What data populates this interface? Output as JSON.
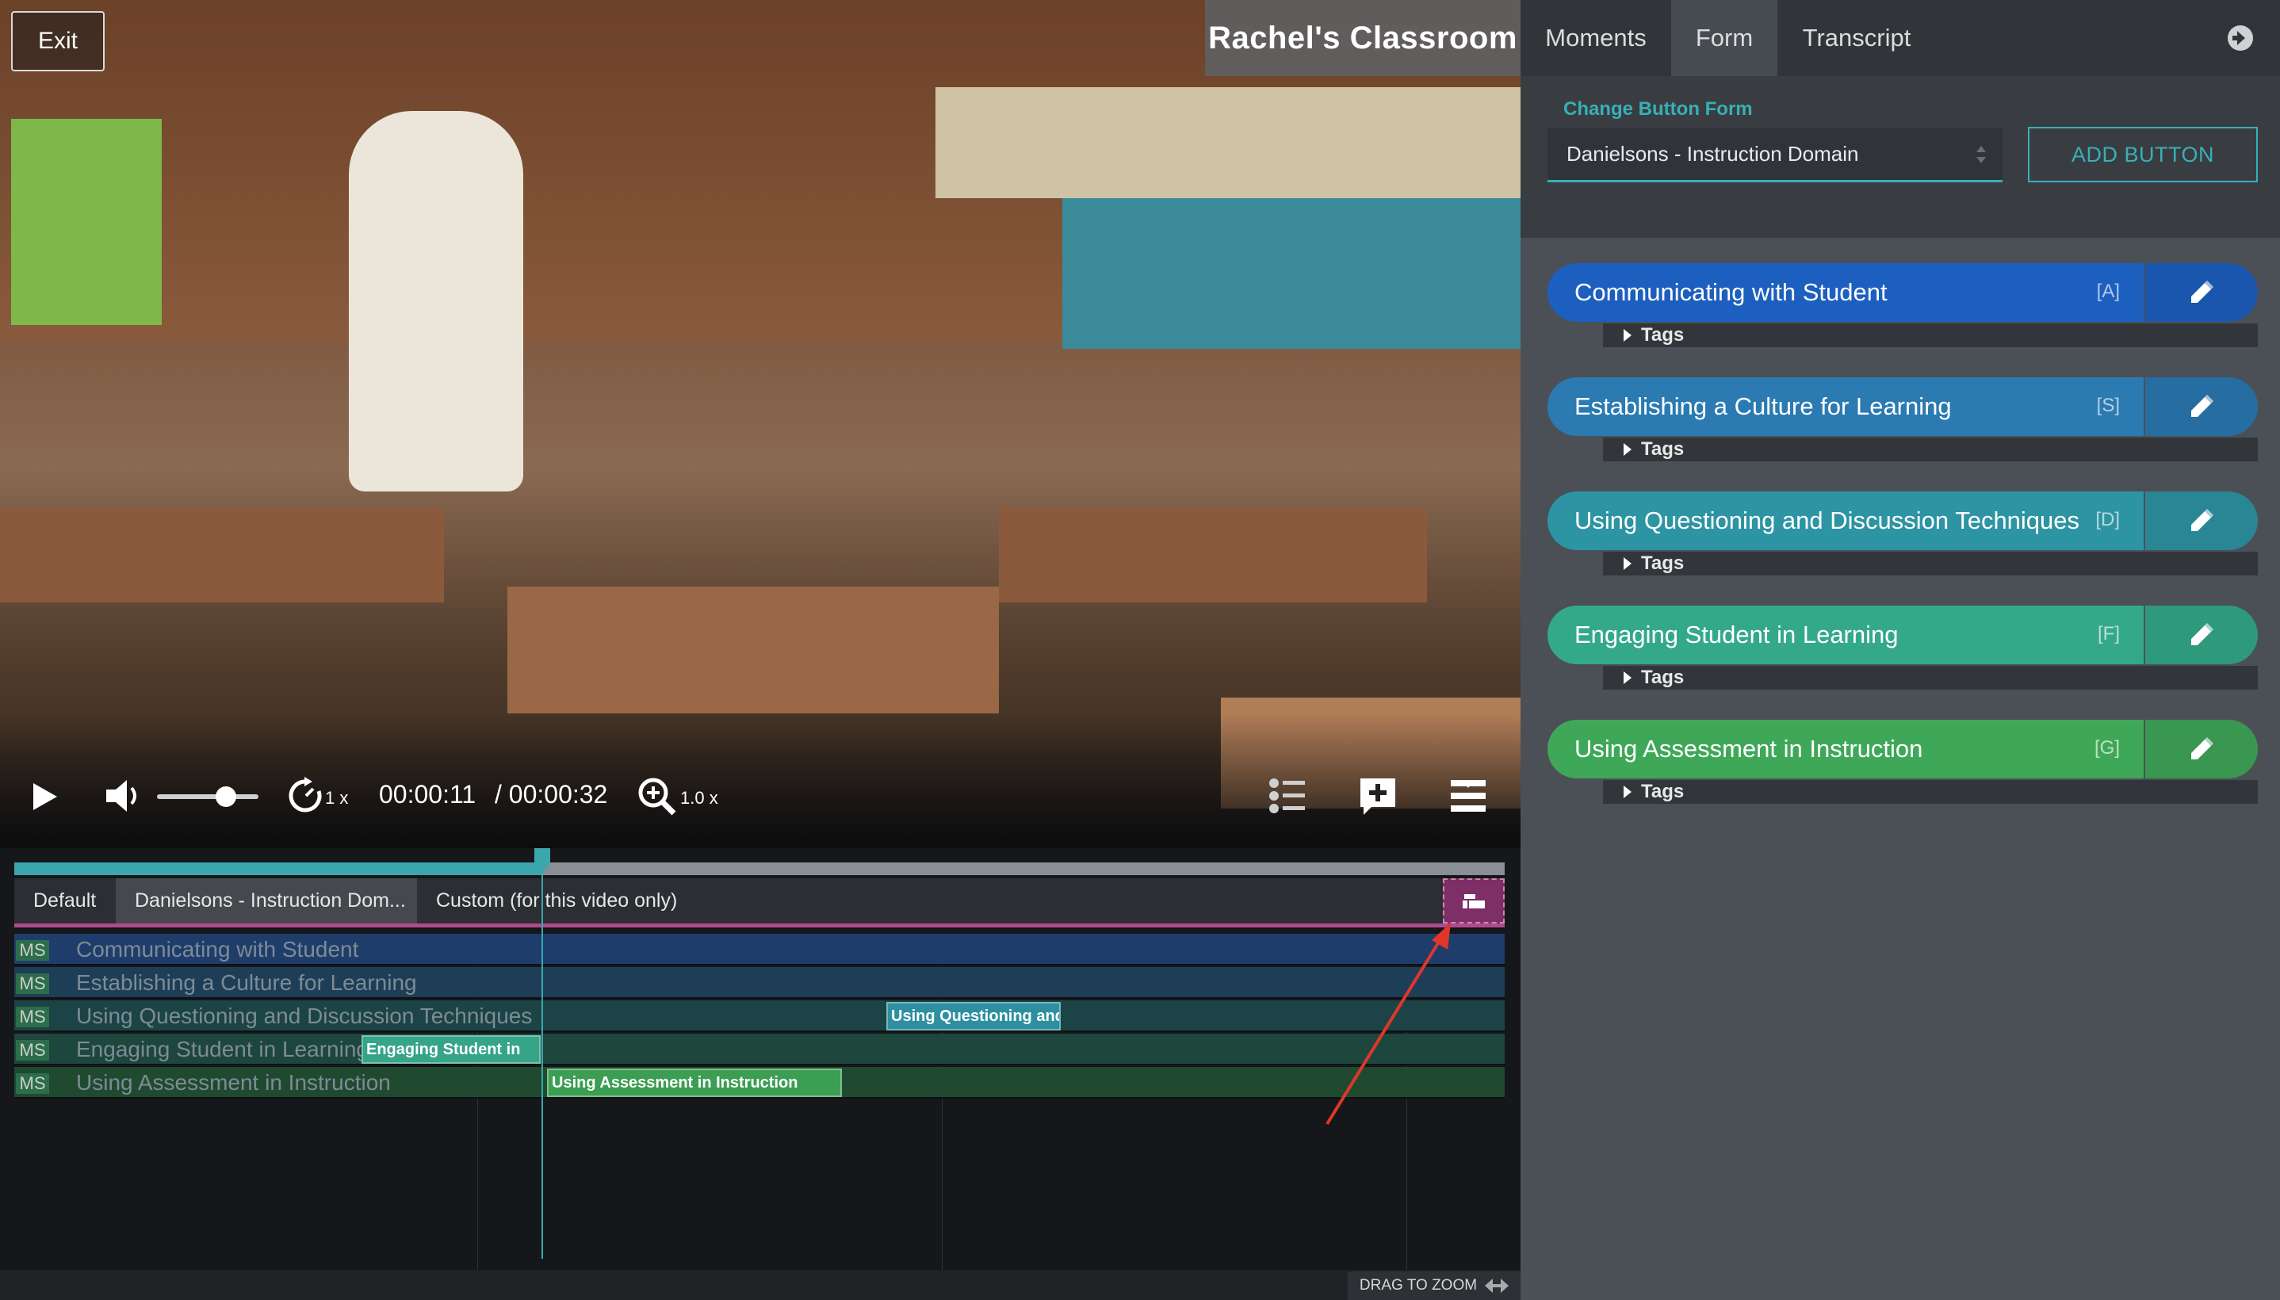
{
  "video": {
    "exit_label": "Exit",
    "title": "Rachel's Classroom",
    "speed": "1 x",
    "time_current": "00:00:11",
    "time_total": "/ 00:00:32",
    "zoom": "1.0 x",
    "progress_fraction": 0.354
  },
  "timeline": {
    "tabs": [
      "Default",
      "Danielsons - Instruction Dom...",
      "Custom (for this video only)"
    ],
    "rows": [
      {
        "badge": "MS",
        "label": "Communicating with Student",
        "color": "#1f3d6b"
      },
      {
        "badge": "MS",
        "label": "Establishing a Culture for Learning",
        "color": "#1e3e57"
      },
      {
        "badge": "MS",
        "label": "Using Questioning and Discussion Techniques",
        "color": "#1c4446"
      },
      {
        "badge": "MS",
        "label": "Engaging Student in Learning",
        "color": "#1d463c"
      },
      {
        "badge": "MS",
        "label": "Using Assessment in Instruction",
        "color": "#1f4a30"
      }
    ],
    "clips": [
      {
        "row": 2,
        "label": "Using Questioning and",
        "color": "#2d8fa0"
      },
      {
        "row": 3,
        "label": "Engaging Student in",
        "color": "#35a488"
      },
      {
        "row": 4,
        "label": "Using Assessment in Instruction",
        "color": "#3c9e53"
      }
    ],
    "drag_zoom": "DRAG TO ZOOM"
  },
  "panel": {
    "tabs": [
      "Moments",
      "Form",
      "Transcript"
    ],
    "change_form_label": "Change Button Form",
    "form_selected": "Danielsons - Instruction Domain",
    "add_button_label": "ADD BUTTON",
    "buttons": [
      {
        "label": "Communicating with Student",
        "key": "[A]",
        "color": "#1d5fbf",
        "edit_color": "#1a56ae",
        "tags": "Tags"
      },
      {
        "label": "Establishing a Culture for Learning",
        "key": "[S]",
        "color": "#2b7ab2",
        "edit_color": "#266ea2",
        "tags": "Tags"
      },
      {
        "label": "Using Questioning and Discussion Techniques",
        "key": "[D]",
        "color": "#2d94a3",
        "edit_color": "#298694",
        "tags": "Tags"
      },
      {
        "label": "Engaging Student in Learning",
        "key": "[F]",
        "color": "#34a989",
        "edit_color": "#2f997c",
        "tags": "Tags"
      },
      {
        "label": "Using Assessment in Instruction",
        "key": "[G]",
        "color": "#3fa858",
        "edit_color": "#399750",
        "tags": "Tags"
      }
    ]
  }
}
